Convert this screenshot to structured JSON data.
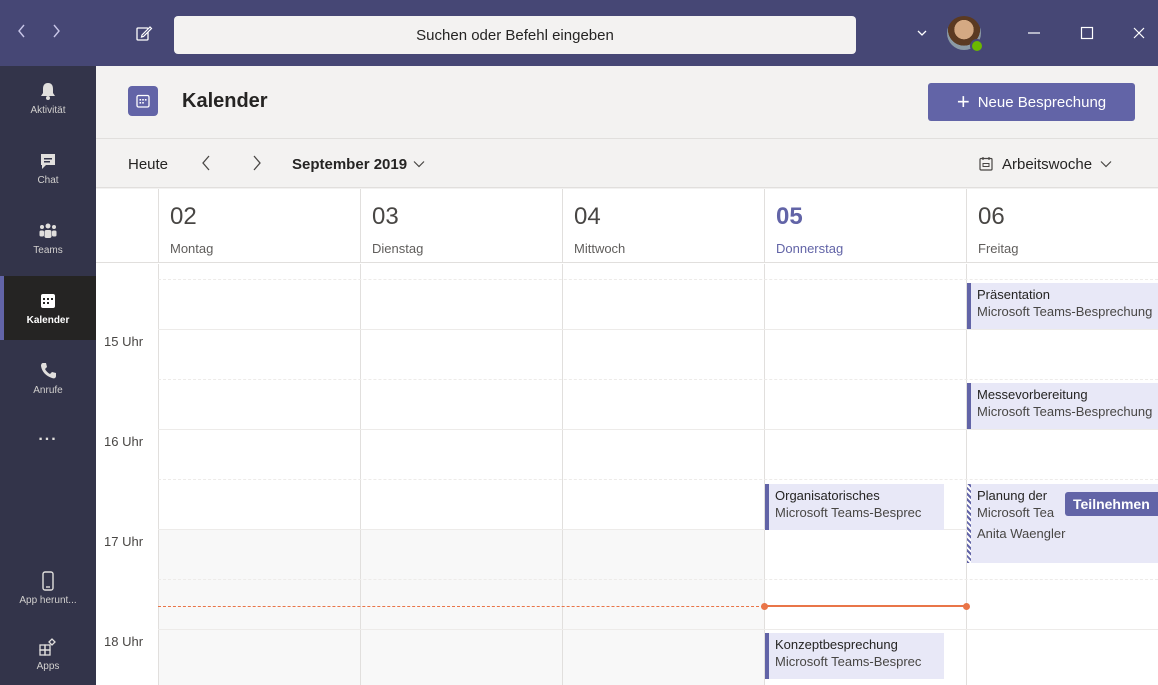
{
  "titlebar": {
    "search_placeholder": "Suchen oder Befehl eingeben",
    "icons": [
      "back-icon",
      "forward-icon",
      "compose-icon",
      "chevron-down-icon",
      "minimize-icon",
      "maximize-icon",
      "close-icon"
    ],
    "presence_color": "#6bb700"
  },
  "rail": {
    "items": [
      {
        "label": "Aktivität",
        "icon": "bell-icon"
      },
      {
        "label": "Chat",
        "icon": "chat-icon"
      },
      {
        "label": "Teams",
        "icon": "teams-icon"
      },
      {
        "label": "Kalender",
        "icon": "calendar-icon",
        "active": true
      },
      {
        "label": "Anrufe",
        "icon": "phone-icon"
      },
      {
        "label": "...",
        "icon": "more-icon"
      },
      {
        "label": "App herunt...",
        "icon": "mobile-icon"
      },
      {
        "label": "Apps",
        "icon": "apps-icon"
      }
    ]
  },
  "header": {
    "title": "Kalender",
    "new_meeting_label": "Neue Besprechung",
    "accent": "#6264a7"
  },
  "toolbar": {
    "today_label": "Heute",
    "month_label": "September 2019",
    "view_label": "Arbeitswoche"
  },
  "days": [
    {
      "num": "02",
      "name": "Montag"
    },
    {
      "num": "03",
      "name": "Dienstag"
    },
    {
      "num": "04",
      "name": "Mittwoch"
    },
    {
      "num": "05",
      "name": "Donnerstag",
      "today": true
    },
    {
      "num": "06",
      "name": "Freitag"
    }
  ],
  "hours": [
    "15 Uhr",
    "16 Uhr",
    "17 Uhr",
    "18 Uhr"
  ],
  "events": [
    {
      "title": "Präsentation",
      "sub": "Microsoft Teams-Besprechung",
      "day": "Freitag"
    },
    {
      "title": "Messevorbereitung",
      "sub": "Microsoft Teams-Besprechung",
      "day": "Freitag"
    },
    {
      "title": "Organisatorisches",
      "sub": "Microsoft Teams-Besprec",
      "day": "Donnerstag"
    },
    {
      "title": "Planung der",
      "sub": "Microsoft Tea",
      "organizer": "Anita Waengler",
      "badge": "Teilnehmen",
      "day": "Freitag"
    },
    {
      "title": "Konzeptbesprechung",
      "sub": "Microsoft Teams-Besprec",
      "day": "Donnerstag"
    }
  ],
  "now_color": "#e97548"
}
